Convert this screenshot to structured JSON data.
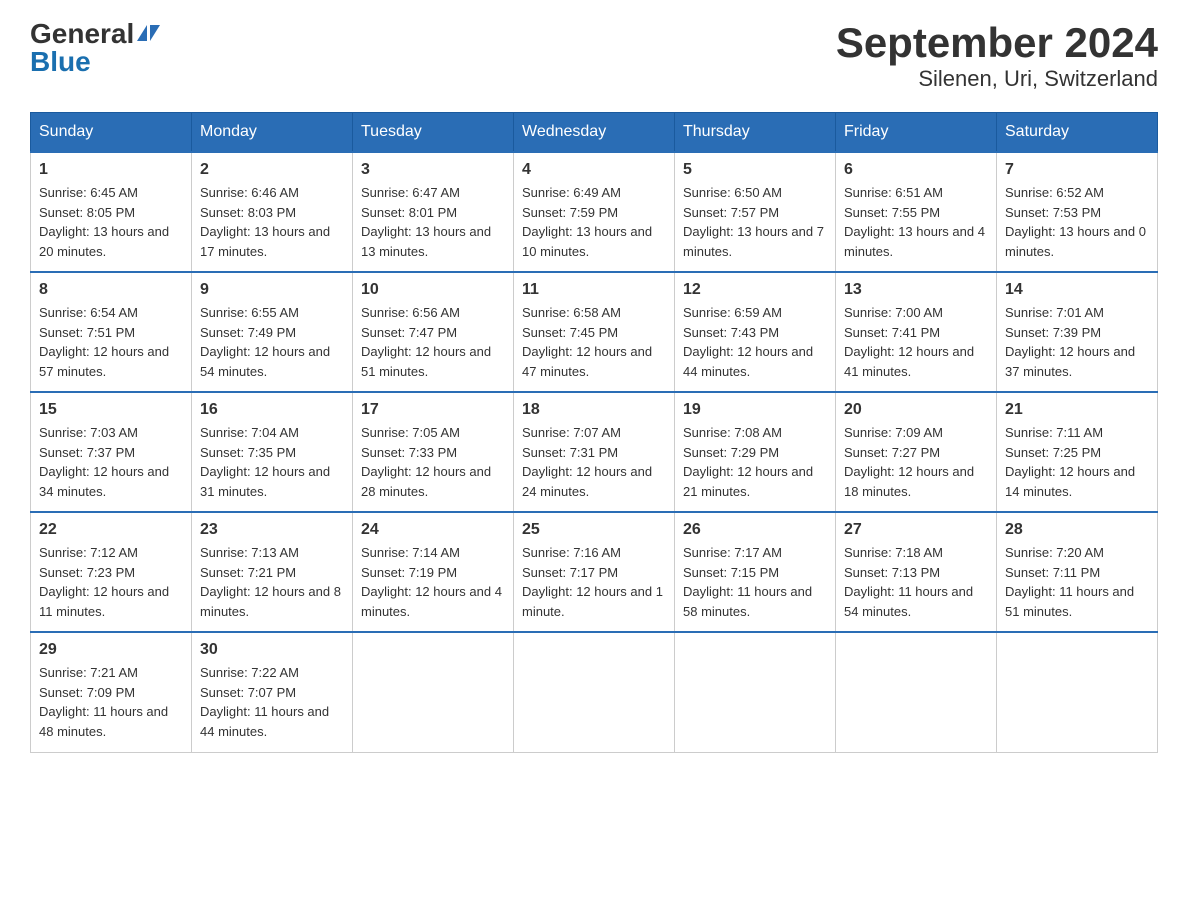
{
  "header": {
    "logo_text_general": "General",
    "logo_text_blue": "Blue",
    "title": "September 2024",
    "subtitle": "Silenen, Uri, Switzerland"
  },
  "days_of_week": [
    "Sunday",
    "Monday",
    "Tuesday",
    "Wednesday",
    "Thursday",
    "Friday",
    "Saturday"
  ],
  "weeks": [
    [
      {
        "day": "1",
        "sunrise": "6:45 AM",
        "sunset": "8:05 PM",
        "daylight": "13 hours and 20 minutes."
      },
      {
        "day": "2",
        "sunrise": "6:46 AM",
        "sunset": "8:03 PM",
        "daylight": "13 hours and 17 minutes."
      },
      {
        "day": "3",
        "sunrise": "6:47 AM",
        "sunset": "8:01 PM",
        "daylight": "13 hours and 13 minutes."
      },
      {
        "day": "4",
        "sunrise": "6:49 AM",
        "sunset": "7:59 PM",
        "daylight": "13 hours and 10 minutes."
      },
      {
        "day": "5",
        "sunrise": "6:50 AM",
        "sunset": "7:57 PM",
        "daylight": "13 hours and 7 minutes."
      },
      {
        "day": "6",
        "sunrise": "6:51 AM",
        "sunset": "7:55 PM",
        "daylight": "13 hours and 4 minutes."
      },
      {
        "day": "7",
        "sunrise": "6:52 AM",
        "sunset": "7:53 PM",
        "daylight": "13 hours and 0 minutes."
      }
    ],
    [
      {
        "day": "8",
        "sunrise": "6:54 AM",
        "sunset": "7:51 PM",
        "daylight": "12 hours and 57 minutes."
      },
      {
        "day": "9",
        "sunrise": "6:55 AM",
        "sunset": "7:49 PM",
        "daylight": "12 hours and 54 minutes."
      },
      {
        "day": "10",
        "sunrise": "6:56 AM",
        "sunset": "7:47 PM",
        "daylight": "12 hours and 51 minutes."
      },
      {
        "day": "11",
        "sunrise": "6:58 AM",
        "sunset": "7:45 PM",
        "daylight": "12 hours and 47 minutes."
      },
      {
        "day": "12",
        "sunrise": "6:59 AM",
        "sunset": "7:43 PM",
        "daylight": "12 hours and 44 minutes."
      },
      {
        "day": "13",
        "sunrise": "7:00 AM",
        "sunset": "7:41 PM",
        "daylight": "12 hours and 41 minutes."
      },
      {
        "day": "14",
        "sunrise": "7:01 AM",
        "sunset": "7:39 PM",
        "daylight": "12 hours and 37 minutes."
      }
    ],
    [
      {
        "day": "15",
        "sunrise": "7:03 AM",
        "sunset": "7:37 PM",
        "daylight": "12 hours and 34 minutes."
      },
      {
        "day": "16",
        "sunrise": "7:04 AM",
        "sunset": "7:35 PM",
        "daylight": "12 hours and 31 minutes."
      },
      {
        "day": "17",
        "sunrise": "7:05 AM",
        "sunset": "7:33 PM",
        "daylight": "12 hours and 28 minutes."
      },
      {
        "day": "18",
        "sunrise": "7:07 AM",
        "sunset": "7:31 PM",
        "daylight": "12 hours and 24 minutes."
      },
      {
        "day": "19",
        "sunrise": "7:08 AM",
        "sunset": "7:29 PM",
        "daylight": "12 hours and 21 minutes."
      },
      {
        "day": "20",
        "sunrise": "7:09 AM",
        "sunset": "7:27 PM",
        "daylight": "12 hours and 18 minutes."
      },
      {
        "day": "21",
        "sunrise": "7:11 AM",
        "sunset": "7:25 PM",
        "daylight": "12 hours and 14 minutes."
      }
    ],
    [
      {
        "day": "22",
        "sunrise": "7:12 AM",
        "sunset": "7:23 PM",
        "daylight": "12 hours and 11 minutes."
      },
      {
        "day": "23",
        "sunrise": "7:13 AM",
        "sunset": "7:21 PM",
        "daylight": "12 hours and 8 minutes."
      },
      {
        "day": "24",
        "sunrise": "7:14 AM",
        "sunset": "7:19 PM",
        "daylight": "12 hours and 4 minutes."
      },
      {
        "day": "25",
        "sunrise": "7:16 AM",
        "sunset": "7:17 PM",
        "daylight": "12 hours and 1 minute."
      },
      {
        "day": "26",
        "sunrise": "7:17 AM",
        "sunset": "7:15 PM",
        "daylight": "11 hours and 58 minutes."
      },
      {
        "day": "27",
        "sunrise": "7:18 AM",
        "sunset": "7:13 PM",
        "daylight": "11 hours and 54 minutes."
      },
      {
        "day": "28",
        "sunrise": "7:20 AM",
        "sunset": "7:11 PM",
        "daylight": "11 hours and 51 minutes."
      }
    ],
    [
      {
        "day": "29",
        "sunrise": "7:21 AM",
        "sunset": "7:09 PM",
        "daylight": "11 hours and 48 minutes."
      },
      {
        "day": "30",
        "sunrise": "7:22 AM",
        "sunset": "7:07 PM",
        "daylight": "11 hours and 44 minutes."
      },
      null,
      null,
      null,
      null,
      null
    ]
  ],
  "labels": {
    "sunrise": "Sunrise:",
    "sunset": "Sunset:",
    "daylight": "Daylight:"
  }
}
